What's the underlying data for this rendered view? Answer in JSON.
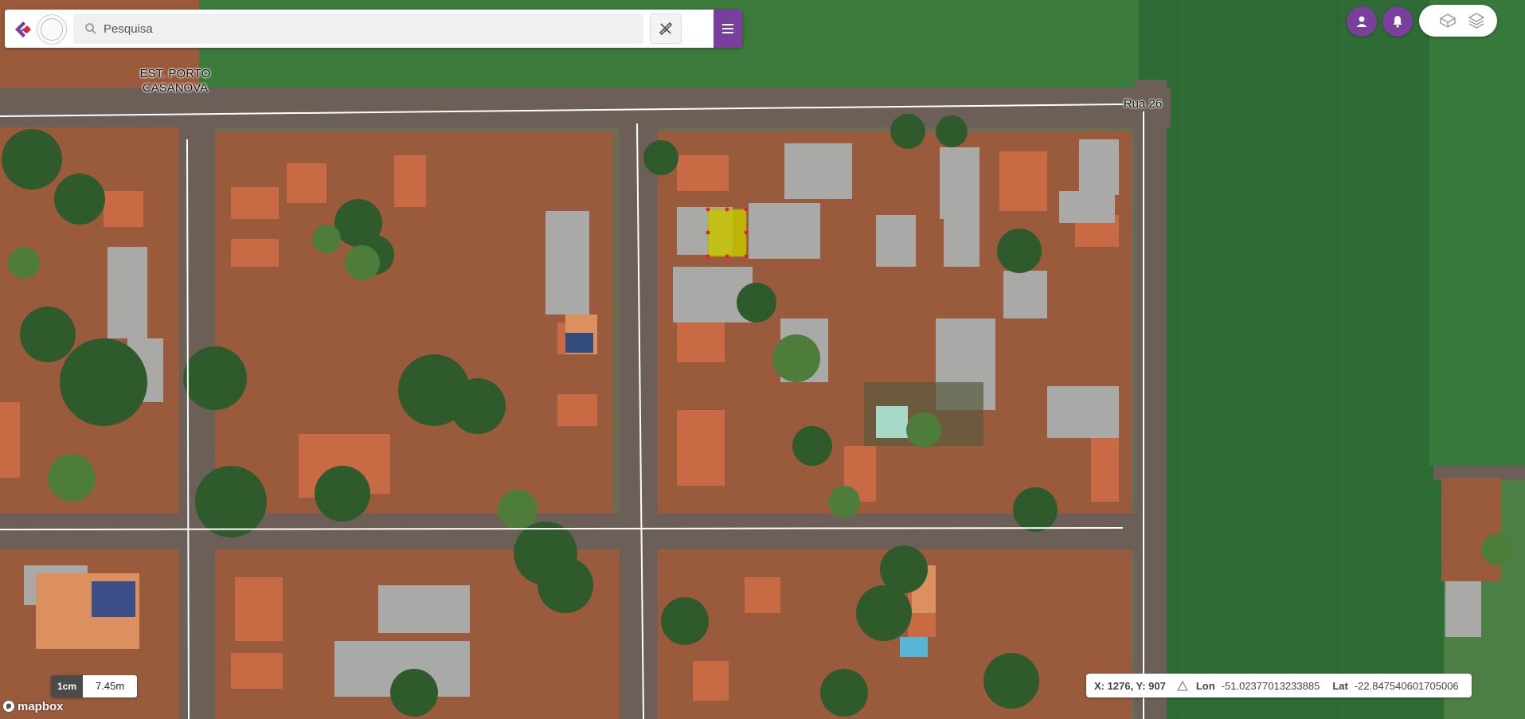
{
  "search": {
    "placeholder": "Pesquisa"
  },
  "map": {
    "labels": {
      "est_line1": "EST. PORTO",
      "est_line2": "CASANOVA",
      "rua": "Rua 26"
    },
    "scale": {
      "unit": "1cm",
      "distance": "7.45m"
    },
    "attribution": "mapbox"
  },
  "coords": {
    "xy": "X: 1276, Y: 907",
    "lon_label": "Lon",
    "lon_value": "-51.02377013233885",
    "lat_label": "Lat",
    "lat_value": "-22.847540601705006"
  },
  "colors": {
    "accent": "#7a3e9d",
    "highlight": "#c7c400",
    "vertex": "#e5212c"
  },
  "icons": [
    "search-icon",
    "ruler-pencil-icon",
    "hamburger-icon",
    "user-icon",
    "bell-icon",
    "layers-icon",
    "layers-stack-icon"
  ]
}
